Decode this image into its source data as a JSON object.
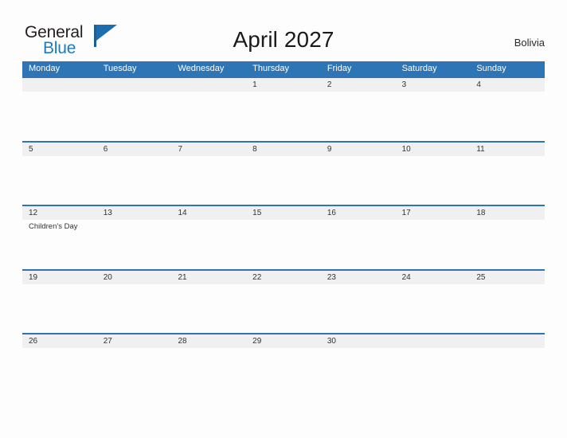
{
  "brand": {
    "logo_primary": "General",
    "logo_secondary": "Blue",
    "logo_icon": "flag-triangle-icon",
    "primary_color": "#2e75b6",
    "secondary_color": "#1a7ac4",
    "band_color": "#f0f0f0"
  },
  "header": {
    "title": "April 2027",
    "country": "Bolivia"
  },
  "calendar": {
    "weekdays": [
      "Monday",
      "Tuesday",
      "Wednesday",
      "Thursday",
      "Friday",
      "Saturday",
      "Sunday"
    ],
    "weeks": [
      {
        "days": [
          {
            "date": "",
            "events": []
          },
          {
            "date": "",
            "events": []
          },
          {
            "date": "",
            "events": []
          },
          {
            "date": "1",
            "events": []
          },
          {
            "date": "2",
            "events": []
          },
          {
            "date": "3",
            "events": []
          },
          {
            "date": "4",
            "events": []
          }
        ]
      },
      {
        "days": [
          {
            "date": "5",
            "events": []
          },
          {
            "date": "6",
            "events": []
          },
          {
            "date": "7",
            "events": []
          },
          {
            "date": "8",
            "events": []
          },
          {
            "date": "9",
            "events": []
          },
          {
            "date": "10",
            "events": []
          },
          {
            "date": "11",
            "events": []
          }
        ]
      },
      {
        "days": [
          {
            "date": "12",
            "events": [
              "Children's Day"
            ]
          },
          {
            "date": "13",
            "events": []
          },
          {
            "date": "14",
            "events": []
          },
          {
            "date": "15",
            "events": []
          },
          {
            "date": "16",
            "events": []
          },
          {
            "date": "17",
            "events": []
          },
          {
            "date": "18",
            "events": []
          }
        ]
      },
      {
        "days": [
          {
            "date": "19",
            "events": []
          },
          {
            "date": "20",
            "events": []
          },
          {
            "date": "21",
            "events": []
          },
          {
            "date": "22",
            "events": []
          },
          {
            "date": "23",
            "events": []
          },
          {
            "date": "24",
            "events": []
          },
          {
            "date": "25",
            "events": []
          }
        ]
      },
      {
        "days": [
          {
            "date": "26",
            "events": []
          },
          {
            "date": "27",
            "events": []
          },
          {
            "date": "28",
            "events": []
          },
          {
            "date": "29",
            "events": []
          },
          {
            "date": "30",
            "events": []
          },
          {
            "date": "",
            "events": []
          },
          {
            "date": "",
            "events": []
          }
        ]
      }
    ]
  }
}
